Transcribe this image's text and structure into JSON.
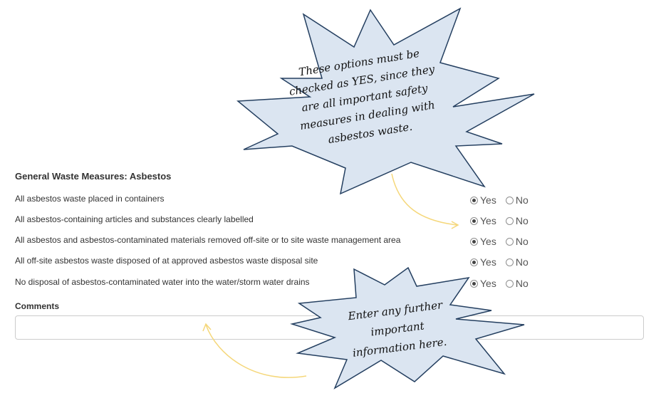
{
  "form": {
    "section_title": "General Waste Measures: Asbestos",
    "questions": [
      {
        "label": "All asbestos waste placed in containers",
        "yes": "Yes",
        "no": "No",
        "selected": "Yes"
      },
      {
        "label": "All asbestos-containing articles and substances clearly labelled",
        "yes": "Yes",
        "no": "No",
        "selected": "Yes"
      },
      {
        "label": "All asbestos and asbestos-contaminated materials removed off-site or to site waste management area",
        "yes": "Yes",
        "no": "No",
        "selected": "Yes"
      },
      {
        "label": "All off-site asbestos waste disposed of at approved asbestos waste disposal site",
        "yes": "Yes",
        "no": "No",
        "selected": "Yes"
      },
      {
        "label": "No disposal of asbestos-contaminated water into the water/storm water drains",
        "yes": "Yes",
        "no": "No",
        "selected": "Yes"
      }
    ],
    "comments_label": "Comments",
    "comments_value": ""
  },
  "callouts": [
    {
      "lines": [
        "These options must be",
        "checked as YES, since they",
        "are all important safety",
        "measures in dealing with",
        "asbestos waste."
      ]
    },
    {
      "lines": [
        "Enter any further",
        "important",
        "information here."
      ]
    }
  ],
  "colors": {
    "callout_fill": "#dbe5f1",
    "callout_stroke": "#243f60",
    "arrow": "#f5d77a",
    "text": "#333333",
    "input_border": "#cccccc"
  }
}
